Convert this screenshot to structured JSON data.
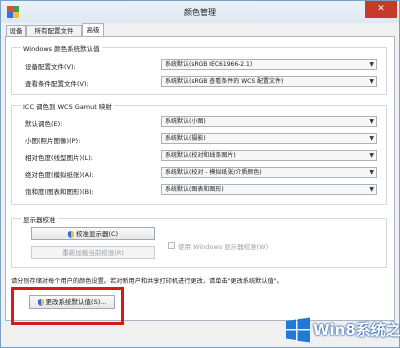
{
  "window": {
    "title": "颜色管理",
    "close_label": "✕"
  },
  "tabs": [
    {
      "label": "设备",
      "active": false
    },
    {
      "label": "所有配置文件",
      "active": false
    },
    {
      "label": "高级",
      "active": true
    }
  ],
  "windows_defaults": {
    "title": "Windows 颜色系统默认值",
    "rows": [
      {
        "label": "设备配置文件(V):",
        "value": "系统默认(sRGB IEC61966-2.1)"
      },
      {
        "label": "查看条件配置文件(V):",
        "value": "系统默认(sRGB 查看条件的 WCS 配置文件)"
      }
    ]
  },
  "icc": {
    "title": "ICC 调色到 WCS Gamut 映射",
    "rows": [
      {
        "label": "默认调色(E):",
        "value": "系统默认(小图)"
      },
      {
        "label": "小图(照片图像)(P):",
        "value": "系统默认(摄影)"
      },
      {
        "label": "相对色度(线型图片)(L):",
        "value": "系统默认(校对和线条图片)"
      },
      {
        "label": "绝对色度(模拟纸张)(A):",
        "value": "系统默认(校对 - 模拟纸张/介质颜色)"
      },
      {
        "label": "饱和度(图表和图形)(B):",
        "value": "系统默认(图表和图形)"
      }
    ]
  },
  "calibration": {
    "title": "显示器校准",
    "calibrate_button": "校准显示器(C)",
    "reload_button": "重新加载当前校准(R)",
    "use_windows_calibration": "使用 Windows 显示器校准(W)"
  },
  "footer": {
    "note": "请分别存储对每个用户的颜色设置。若对新用户和共享打印机进行更改，请单击\"更改系统默认值\"。",
    "change_defaults_button": "更改系统默认值(S)..."
  },
  "watermark": {
    "text": "Win8系统之家"
  },
  "colors": {
    "highlight": "#d21b1b",
    "watermark_blue": "#1e5aa8"
  }
}
